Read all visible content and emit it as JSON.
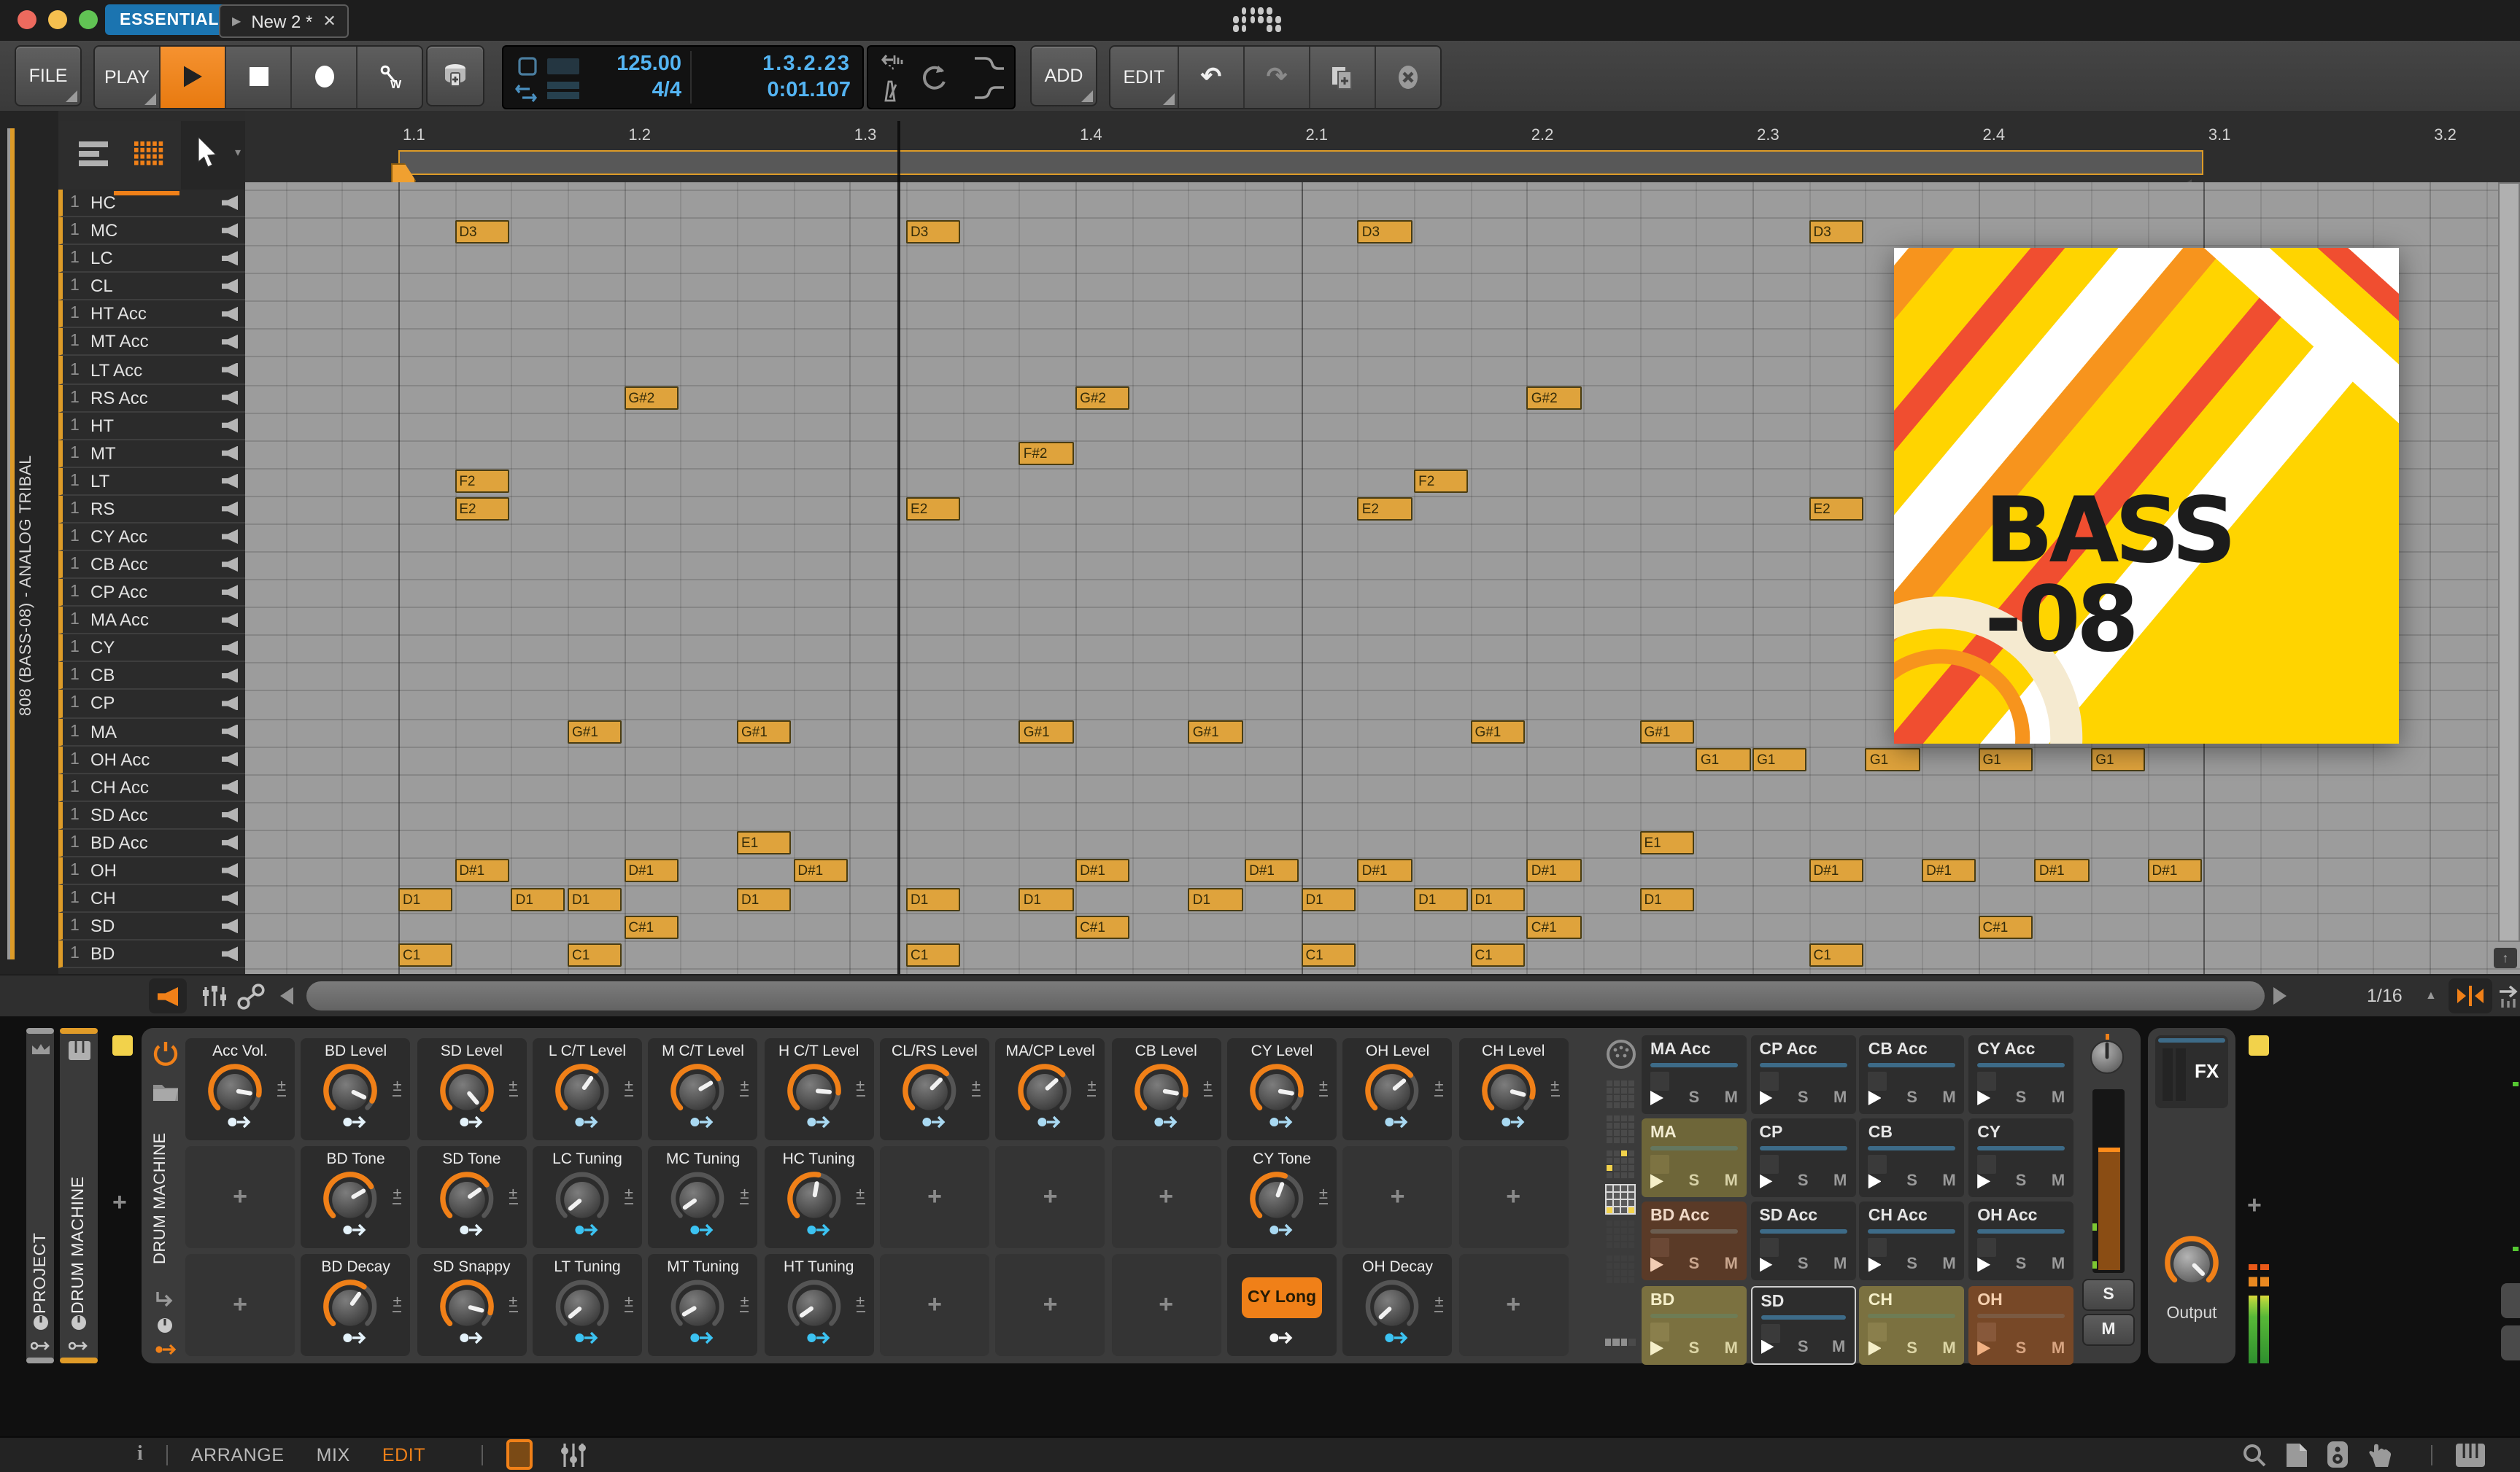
{
  "titlebar": {
    "project_tab": "ESSENTIALS",
    "doc_tab": "New 2 *",
    "doc_play_glyph": "▶",
    "close_glyph": "✕"
  },
  "transport": {
    "file": "FILE",
    "play": "PLAY",
    "tempo": "125.00",
    "time_signature": "4/4",
    "position": "1.3.2.23",
    "time": "0:01.107",
    "add": "ADD",
    "edit": "EDIT"
  },
  "ruler": {
    "labels": [
      "1.1",
      "1.2",
      "1.3",
      "1.4",
      "2.1",
      "2.2",
      "2.3",
      "2.4",
      "3.1",
      "3.2"
    ]
  },
  "clip": {
    "vertical_label": "808 (BASS-08) - ANALOG TRIBAL"
  },
  "tracks": [
    {
      "num": "1",
      "name": "HC"
    },
    {
      "num": "1",
      "name": "MC"
    },
    {
      "num": "1",
      "name": "LC"
    },
    {
      "num": "1",
      "name": "CL"
    },
    {
      "num": "1",
      "name": "HT Acc"
    },
    {
      "num": "1",
      "name": "MT Acc"
    },
    {
      "num": "1",
      "name": "LT Acc"
    },
    {
      "num": "1",
      "name": "RS Acc"
    },
    {
      "num": "1",
      "name": "HT"
    },
    {
      "num": "1",
      "name": "MT"
    },
    {
      "num": "1",
      "name": "LT"
    },
    {
      "num": "1",
      "name": "RS"
    },
    {
      "num": "1",
      "name": "CY Acc"
    },
    {
      "num": "1",
      "name": "CB Acc"
    },
    {
      "num": "1",
      "name": "CP Acc"
    },
    {
      "num": "1",
      "name": "MA Acc"
    },
    {
      "num": "1",
      "name": "CY"
    },
    {
      "num": "1",
      "name": "CB"
    },
    {
      "num": "1",
      "name": "CP"
    },
    {
      "num": "1",
      "name": "MA"
    },
    {
      "num": "1",
      "name": "OH Acc"
    },
    {
      "num": "1",
      "name": "CH Acc"
    },
    {
      "num": "1",
      "name": "SD Acc"
    },
    {
      "num": "1",
      "name": "BD Acc"
    },
    {
      "num": "1",
      "name": "OH"
    },
    {
      "num": "1",
      "name": "CH"
    },
    {
      "num": "1",
      "name": "SD"
    },
    {
      "num": "1",
      "name": "BD"
    }
  ],
  "notes": [
    {
      "label": "D3",
      "track": "MC",
      "steps": [
        1,
        9,
        17,
        25
      ]
    },
    {
      "label": "G#2",
      "track": "RS Acc",
      "steps": [
        4,
        12,
        20
      ]
    },
    {
      "label": "F#2",
      "track": "MT",
      "steps": [
        11
      ]
    },
    {
      "label": "F2",
      "track": "LT",
      "steps": [
        1,
        18
      ]
    },
    {
      "label": "E2",
      "track": "RS",
      "steps": [
        1,
        9,
        17,
        25
      ]
    },
    {
      "label": "G#1",
      "track": "MA",
      "steps": [
        3,
        6,
        11,
        14,
        19,
        22
      ]
    },
    {
      "label": "G1",
      "track": "OH Acc",
      "steps": [
        23,
        24,
        26,
        28,
        30
      ]
    },
    {
      "label": "E1",
      "track": "BD Acc",
      "steps": [
        6,
        22
      ]
    },
    {
      "label": "D#1",
      "track": "OH",
      "steps": [
        1,
        4,
        7,
        12,
        15,
        17,
        20,
        25,
        27,
        29,
        31
      ]
    },
    {
      "label": "D1",
      "track": "CH",
      "steps": [
        0,
        2,
        3,
        6,
        9,
        11,
        14,
        16,
        18,
        19,
        22
      ]
    },
    {
      "label": "C#1",
      "track": "SD",
      "steps": [
        4,
        12,
        20,
        28
      ]
    },
    {
      "label": "C1",
      "track": "BD",
      "steps": [
        0,
        3,
        9,
        16,
        19,
        25
      ]
    }
  ],
  "editor_toolbar": {
    "snap_value": "1/16"
  },
  "artwork": {
    "line1": "BASS",
    "line2": "-08"
  },
  "device": {
    "rails": [
      {
        "label": "PROJECT"
      },
      {
        "label": "DRUM MACHINE"
      }
    ],
    "name": "DRUM MACHINE",
    "fx_label": "FX",
    "output_label": "Output",
    "solo": "S",
    "mute": "M",
    "play_glyph": "▶",
    "cells": [
      [
        {
          "type": "knob",
          "label": "Acc Vol.",
          "angle": 100,
          "arc": "orange",
          "arrow": "pale"
        },
        {
          "type": "knob",
          "label": "BD Level",
          "angle": 115,
          "arc": "orange",
          "arrow": "pale"
        },
        {
          "type": "knob",
          "label": "SD Level",
          "angle": 140,
          "arc": "orange",
          "arrow": "pale"
        },
        {
          "type": "knob",
          "label": "L C/T Level",
          "angle": 35,
          "arc": "orange",
          "arrow": "blue"
        },
        {
          "type": "knob",
          "label": "M C/T Level",
          "angle": 60,
          "arc": "orange",
          "arrow": "blue"
        },
        {
          "type": "knob",
          "label": "H C/T Level",
          "angle": 95,
          "arc": "orange",
          "arrow": "blue"
        },
        {
          "type": "knob",
          "label": "CL/RS Level",
          "angle": 45,
          "arc": "orange",
          "arrow": "blue"
        },
        {
          "type": "knob",
          "label": "MA/CP Level",
          "angle": 48,
          "arc": "orange",
          "arrow": "blue"
        },
        {
          "type": "knob",
          "label": "CB Level",
          "angle": 100,
          "arc": "orange",
          "arrow": "blue"
        },
        {
          "type": "knob",
          "label": "CY Level",
          "angle": 100,
          "arc": "orange",
          "arrow": "blue"
        },
        {
          "type": "knob",
          "label": "OH Level",
          "angle": 50,
          "arc": "orange",
          "arrow": "blue"
        },
        {
          "type": "knob",
          "label": "CH Level",
          "angle": 105,
          "arc": "orange",
          "arrow": "blue"
        }
      ],
      [
        {
          "type": "empty"
        },
        {
          "type": "knob",
          "label": "BD Tone",
          "angle": 60,
          "arc": "orange",
          "arrow": "pale"
        },
        {
          "type": "knob",
          "label": "SD Tone",
          "angle": 55,
          "arc": "orange",
          "arrow": "pale"
        },
        {
          "type": "knob",
          "label": "LC Tuning",
          "angle": -130,
          "arc": "none",
          "arrow": "cyan"
        },
        {
          "type": "knob",
          "label": "MC Tuning",
          "angle": -125,
          "arc": "none",
          "arrow": "cyan"
        },
        {
          "type": "knob",
          "label": "HC Tuning",
          "angle": 10,
          "arc": "orange",
          "arrow": "cyan"
        },
        {
          "type": "empty"
        },
        {
          "type": "empty"
        },
        {
          "type": "empty"
        },
        {
          "type": "knob",
          "label": "CY Tone",
          "angle": 20,
          "arc": "orange",
          "arrow": "blue"
        },
        {
          "type": "empty"
        },
        {
          "type": "empty"
        }
      ],
      [
        {
          "type": "empty"
        },
        {
          "type": "knob",
          "label": "BD Decay",
          "angle": 35,
          "arc": "orange",
          "arrow": "pale"
        },
        {
          "type": "knob",
          "label": "SD Snappy",
          "angle": 105,
          "arc": "orange",
          "arrow": "pale"
        },
        {
          "type": "knob",
          "label": "LT Tuning",
          "angle": -130,
          "arc": "none",
          "arrow": "cyan"
        },
        {
          "type": "knob",
          "label": "MT Tuning",
          "angle": -120,
          "arc": "none",
          "arrow": "cyan"
        },
        {
          "type": "knob",
          "label": "HT Tuning",
          "angle": -125,
          "arc": "none",
          "arrow": "cyan"
        },
        {
          "type": "empty"
        },
        {
          "type": "empty"
        },
        {
          "type": "empty"
        },
        {
          "type": "button",
          "label": "CY Long",
          "arrow": "white"
        },
        {
          "type": "knob",
          "label": "OH Decay",
          "angle": -133,
          "arc": "none",
          "arrow": "cyan"
        },
        {
          "type": "empty"
        }
      ]
    ],
    "pads": [
      {
        "name": "MA Acc",
        "style": "dark"
      },
      {
        "name": "CP Acc",
        "style": "dark"
      },
      {
        "name": "CB Acc",
        "style": "dark"
      },
      {
        "name": "CY Acc",
        "style": "dark"
      },
      {
        "name": "MA",
        "style": "olive"
      },
      {
        "name": "CP",
        "style": "dark"
      },
      {
        "name": "CB",
        "style": "dark"
      },
      {
        "name": "CY",
        "style": "dark"
      },
      {
        "name": "BD Acc",
        "style": "brown"
      },
      {
        "name": "SD Acc",
        "style": "dark"
      },
      {
        "name": "CH Acc",
        "style": "dark"
      },
      {
        "name": "OH Acc",
        "style": "dark"
      },
      {
        "name": "BD",
        "style": "olive2"
      },
      {
        "name": "SD",
        "style": "selected"
      },
      {
        "name": "CH",
        "style": "olive2"
      },
      {
        "name": "OH",
        "style": "brown2"
      }
    ]
  },
  "statusbar": {
    "views": [
      "ARRANGE",
      "MIX",
      "EDIT"
    ],
    "active_view": "EDIT"
  },
  "colors": {
    "accent": "#f08018",
    "clip_border": "#dd9b28",
    "note_fill": "#dfa33c",
    "tempo_text": "#54b4f2",
    "project_tab_blue": "#1b74b0",
    "grid_gray": "#9c9c9c",
    "pad_styles": {
      "dark": {
        "bg": "#2d2d2d",
        "fg": "#e6e6e6",
        "bar": "#3d6b88",
        "sq": "#3a3a3a",
        "play": "#ffffff",
        "sm": "#9a9a9a"
      },
      "olive": {
        "bg": "#6e6639",
        "fg": "#f2ecd2",
        "bar": "#64775f",
        "sq": "#7d7342",
        "play": "#f5efc9",
        "sm": "#d8d2a8"
      },
      "olive2": {
        "bg": "#7b7140",
        "fg": "#f5efc9",
        "bar": "#6e7c55",
        "sq": "#8a7f4c",
        "play": "#f5efc9",
        "sm": "#ddd6a6"
      },
      "brown": {
        "bg": "#5a3a27",
        "fg": "#f0d9c8",
        "bar": "#6b5d50",
        "sq": "#6b4835",
        "play": "#f2cdb4",
        "sm": "#c9a68e"
      },
      "brown2": {
        "bg": "#774827",
        "fg": "#f5cfae",
        "bar": "#7a5a42",
        "sq": "#87583a",
        "play": "#f0b183",
        "sm": "#d8a582"
      },
      "selected": {
        "bg": "#2d2d2d",
        "fg": "#e6e6e6",
        "bar": "#3d6b88",
        "sq": "#3a3a3a",
        "play": "#ffffff",
        "sm": "#9a9a9a"
      }
    },
    "arrow_styles": {
      "pale": "#e4f2fa",
      "blue": "#a9d9f2",
      "cyan": "#3cc3f2",
      "white": "#f5f5f5"
    }
  }
}
